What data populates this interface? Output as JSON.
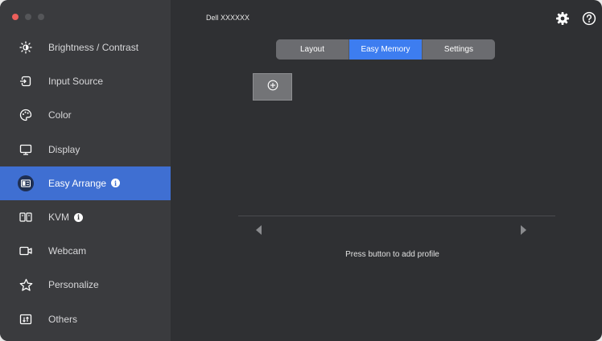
{
  "window": {
    "title": "Dell XXXXXX"
  },
  "sidebar": {
    "items": [
      {
        "label": "Brightness / Contrast",
        "icon": "brightness-icon",
        "active": false,
        "info": false
      },
      {
        "label": "Input Source",
        "icon": "input-source-icon",
        "active": false,
        "info": false
      },
      {
        "label": "Color",
        "icon": "color-palette-icon",
        "active": false,
        "info": false
      },
      {
        "label": "Display",
        "icon": "display-icon",
        "active": false,
        "info": false
      },
      {
        "label": "Easy Arrange",
        "icon": "easy-arrange-icon",
        "active": true,
        "info": true
      },
      {
        "label": "KVM",
        "icon": "kvm-icon",
        "active": false,
        "info": true
      },
      {
        "label": "Webcam",
        "icon": "webcam-icon",
        "active": false,
        "info": false
      },
      {
        "label": "Personalize",
        "icon": "star-icon",
        "active": false,
        "info": false
      },
      {
        "label": "Others",
        "icon": "others-icon",
        "active": false,
        "info": false
      }
    ],
    "info_glyph": "i"
  },
  "header": {
    "settings_icon": "gear-icon",
    "help_icon": "help-icon"
  },
  "tabs": [
    {
      "label": "Layout",
      "active": false
    },
    {
      "label": "Easy Memory",
      "active": true
    },
    {
      "label": "Settings",
      "active": false
    }
  ],
  "easy_memory": {
    "add_icon": "add-circle-icon",
    "prev_icon": "arrow-left-icon",
    "next_icon": "arrow-right-icon",
    "hint": "Press button to add profile"
  },
  "colors": {
    "accent": "#3f6fd2",
    "tab_active": "#3d7df0",
    "sidebar_bg": "#3a3b3e",
    "main_bg": "#2f3033",
    "close_dot": "#ec5f5b"
  }
}
